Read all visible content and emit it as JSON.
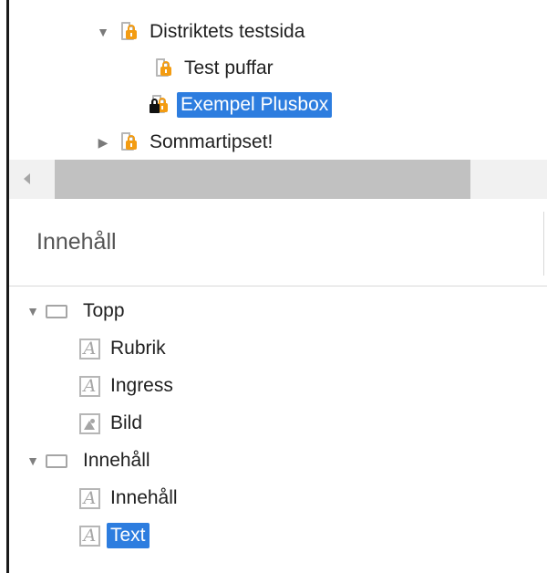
{
  "page_tree": {
    "items": [
      {
        "label": "Distriktets testsida",
        "expanded": true,
        "icon": "locked-page-icon"
      },
      {
        "label": "Test puffar",
        "icon": "locked-page-icon"
      },
      {
        "label": "Exempel Plusbox",
        "selected": true,
        "icon": "private-locked-page-icon"
      },
      {
        "label": "Sommartipset!",
        "expanded": false,
        "icon": "locked-page-icon"
      }
    ]
  },
  "scrollbar": {
    "direction": "horizontal"
  },
  "content": {
    "title": "Innehåll",
    "tree": [
      {
        "label": "Topp",
        "type": "area",
        "expanded": true
      },
      {
        "label": "Rubrik",
        "type": "text-block"
      },
      {
        "label": "Ingress",
        "type": "text-block"
      },
      {
        "label": "Bild",
        "type": "image-block"
      },
      {
        "label": "Innehåll",
        "type": "area",
        "expanded": true
      },
      {
        "label": "Innehåll",
        "type": "text-block"
      },
      {
        "label": "Text",
        "type": "text-block",
        "selected": true
      }
    ]
  },
  "colors": {
    "selection": "#2d7ddf",
    "lock_orange": "#f39c12",
    "scrollbar_track": "#f1f1f1",
    "scrollbar_thumb": "#c1c1c1"
  }
}
